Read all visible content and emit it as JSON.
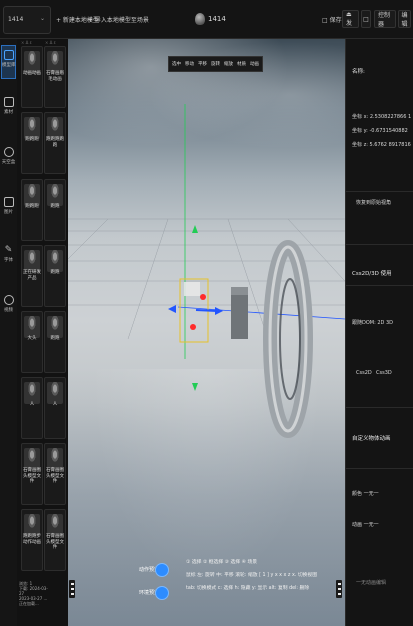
{
  "topbar": {
    "project_select": "1414",
    "project_caret": "⌄",
    "new_local_model": "+ 新建本地模型",
    "import_local": "+ 导入本地模型至场景",
    "title": "1414",
    "save": "□ 保存",
    "publish": "⏏ 发",
    "btn_a": "□",
    "btn_controller": "控制器",
    "btn_last": "编辑"
  },
  "rail": [
    {
      "label": "模型库",
      "icon": "cube-icon",
      "active": true
    },
    {
      "label": "素材",
      "icon": "image-icon",
      "active": false
    },
    {
      "label": "天空盒",
      "icon": "sky-icon",
      "active": false
    },
    {
      "label": "图片",
      "icon": "picture-icon",
      "active": false
    },
    {
      "label": "字体",
      "icon": "pen-icon",
      "active": false
    },
    {
      "label": "视频",
      "icon": "play-icon",
      "active": false
    }
  ],
  "panel": {
    "head_left": "× Δ ε",
    "head_right": "× Δ ε",
    "cards": [
      {
        "label": "动画动画"
      },
      {
        "label": "石膏画眉毛动画"
      },
      {
        "label": "跑跑跑"
      },
      {
        "label": "跑跑跑跑跑"
      },
      {
        "label": "跑跑跑"
      },
      {
        "label": "跑跑"
      },
      {
        "label": "正在研发产品"
      },
      {
        "label": "跑跑"
      },
      {
        "label": "大头"
      },
      {
        "label": "跑跑"
      },
      {
        "label": "人"
      },
      {
        "label": "人"
      },
      {
        "label": "石膏画图头模型文件"
      },
      {
        "label": "石膏画图头模型文件"
      },
      {
        "label": "跑跑跑步动作动画"
      },
      {
        "label": "石膏画图头模型文件"
      }
    ],
    "bottom_info": [
      "浏览: 1",
      "下载: 2024-03-27",
      "2023-03-27 ...",
      "正在加载..."
    ]
  },
  "viewport": {
    "toolbar": [
      "选中",
      "移动",
      "平移",
      "旋转",
      "缩放",
      "材质",
      "动画"
    ],
    "hints": [
      "① 选择 ② 框选择 ③ 选择 ④ 场景",
      "鼠标 左: 旋转 中: 平移 滚轮: 缩放 [ 1 ] y x x x z x. 切换视图",
      "tab: 切换模式 c: 选择 h: 隐藏 y: 显示 alt: 复制 del: 删除"
    ],
    "toggle1": "动作预览",
    "toggle2": "环境预览"
  },
  "rpanel": {
    "name_label": "名称:",
    "coord_x": "坐标 x: 2.5308227866 1",
    "coord_y": "坐标 y: -0.6731540882",
    "coord_z": "坐标 z: 5.6762 8917816",
    "reset_view": "恢复到原始视角",
    "mode_title": "Css2D/3D 使用",
    "dom_label": "跟随DOM: 2D 3D",
    "mode_2d": "Css2D",
    "mode_3d": "Css3D",
    "anim_title": "自定义物体动画",
    "anim_speed": "颜色 一无一",
    "anim_loop": "动画 一无一",
    "anim_btn": "一无动画编辑"
  },
  "colors": {
    "accent": "#2d8cff",
    "bg": "#141414",
    "x_axis": "#2255ff",
    "y_axis": "#22cc55",
    "z_axis": "#ff3333"
  }
}
